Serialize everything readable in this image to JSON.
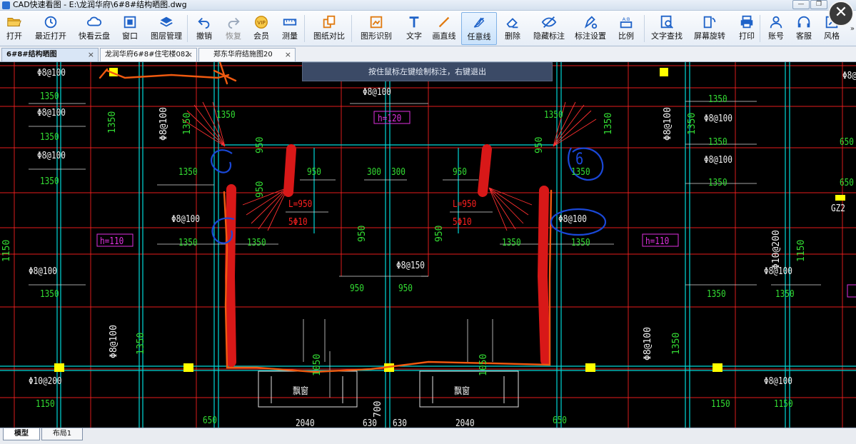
{
  "window": {
    "title": "CAD快速看图 - E:\\龙润华府\\6#8#结构晒图.dwg",
    "minimize_glyph": "—",
    "restore_glyph": "❐",
    "close_overlay_glyph": "✕"
  },
  "toolbar": {
    "items": [
      {
        "label": "打开",
        "icon": "folder-open-icon"
      },
      {
        "label": "最近打开",
        "icon": "recent-clock-icon"
      },
      {
        "label": "快看云盘",
        "icon": "cloud-icon"
      },
      {
        "label": "窗口",
        "icon": "window-icon"
      },
      {
        "label": "图层管理",
        "icon": "layers-icon"
      },
      {
        "label": "撤销",
        "icon": "undo-icon"
      },
      {
        "label": "恢复",
        "icon": "redo-icon"
      },
      {
        "label": "会员",
        "icon": "vip-icon"
      },
      {
        "label": "测量",
        "icon": "ruler-icon"
      },
      {
        "label": "图纸对比",
        "icon": "compare-icon"
      },
      {
        "label": "图形识别",
        "icon": "shape-recognize-icon"
      },
      {
        "label": "文字",
        "icon": "text-icon"
      },
      {
        "label": "画直线",
        "icon": "line-icon"
      },
      {
        "label": "任意线",
        "icon": "freehand-icon"
      },
      {
        "label": "删除",
        "icon": "eraser-icon"
      },
      {
        "label": "隐藏标注",
        "icon": "hide-eye-icon"
      },
      {
        "label": "标注设置",
        "icon": "annotation-settings-icon"
      },
      {
        "label": "比例",
        "icon": "scale-icon"
      },
      {
        "label": "文字查找",
        "icon": "text-search-icon"
      },
      {
        "label": "屏幕旋转",
        "icon": "rotate-screen-icon"
      },
      {
        "label": "打印",
        "icon": "printer-icon"
      },
      {
        "label": "账号",
        "icon": "user-icon"
      },
      {
        "label": "客服",
        "icon": "headset-icon"
      },
      {
        "label": "风格",
        "icon": "style-icon"
      }
    ],
    "overflow_glyph": "»",
    "active_tool": "任意线",
    "accent_color": "#1e62c8"
  },
  "tabs": [
    {
      "label": "6#8#结构晒图",
      "close": "×"
    },
    {
      "label": "龙润华府6#8#住宅楼082",
      "close": "×"
    },
    {
      "label": "郑东华府结施图20",
      "close": "×"
    }
  ],
  "canvas": {
    "hint": "按住鼠标左键绘制标注，右键退出",
    "labels": {
      "rebar_a": "Φ8@100",
      "rebar_b": "Φ8@150",
      "rebar_c": "Φ10@200",
      "dim_1350": "1350",
      "dim_950": "950",
      "dim_300": "300",
      "dim_1150": "1150",
      "dim_650": "650",
      "dim_1050": "1050",
      "dim_700": "700",
      "dim_630": "630",
      "dim_2040": "2040",
      "h120": "h=120",
      "h110": "h=110",
      "L950": "L=950",
      "bars_5phi10": "5Φ10",
      "gz2": "GZ2",
      "window_label": "飘窗",
      "circled_6": "6"
    },
    "colors": {
      "green_text": "#33dd33",
      "white_text": "#f0f0f0",
      "red_line": "#ff2020",
      "cyan_line": "#00d8d8",
      "magenta": "#e030e0",
      "yellow": "#ffff00",
      "markup_red": "#d81818",
      "markup_orange": "#f05a10",
      "markup_blue": "#1a48d8"
    }
  },
  "layout_tabs": [
    {
      "label": "模型"
    },
    {
      "label": "布局1"
    }
  ]
}
